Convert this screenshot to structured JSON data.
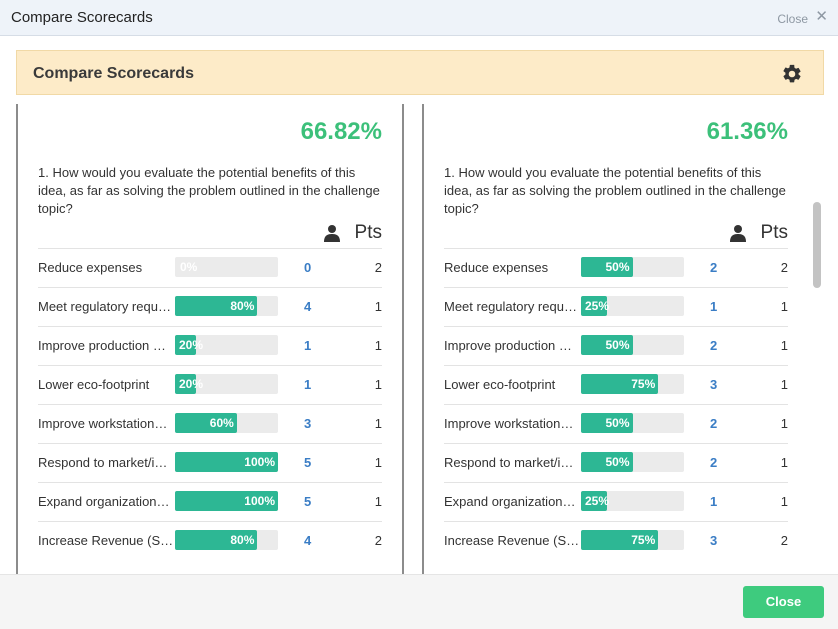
{
  "window": {
    "title": "Compare Scorecards",
    "close_link": "Close",
    "close_x": "✕"
  },
  "header": {
    "title": "Compare Scorecards",
    "gear_icon": "gear-icon"
  },
  "pts_label": "Pts",
  "scorecards": [
    {
      "score": "66.82%",
      "question": "1. How would you evaluate the potential benefits of this idea, as far as solving the problem outlined in the challenge topic?",
      "rows": [
        {
          "label": "Reduce expenses",
          "pct_value": 0,
          "pct": "0%",
          "count": "0",
          "pts": "2"
        },
        {
          "label": "Meet regulatory requ…",
          "pct_value": 80,
          "pct": "80%",
          "count": "4",
          "pts": "1"
        },
        {
          "label": "Improve production …",
          "pct_value": 20,
          "pct": "20%",
          "count": "1",
          "pts": "1"
        },
        {
          "label": "Lower eco-footprint",
          "pct_value": 20,
          "pct": "20%",
          "count": "1",
          "pts": "1"
        },
        {
          "label": "Improve workstation…",
          "pct_value": 60,
          "pct": "60%",
          "count": "3",
          "pts": "1"
        },
        {
          "label": "Respond to market/i…",
          "pct_value": 100,
          "pct": "100%",
          "count": "5",
          "pts": "1"
        },
        {
          "label": "Expand organization…",
          "pct_value": 100,
          "pct": "100%",
          "count": "5",
          "pts": "1"
        },
        {
          "label": "Increase Revenue (Sa…",
          "pct_value": 80,
          "pct": "80%",
          "count": "4",
          "pts": "2"
        }
      ]
    },
    {
      "score": "61.36%",
      "question": "1. How would you evaluate the potential benefits of this idea, as far as solving the problem outlined in the challenge topic?",
      "rows": [
        {
          "label": "Reduce expenses",
          "pct_value": 50,
          "pct": "50%",
          "count": "2",
          "pts": "2"
        },
        {
          "label": "Meet regulatory requ…",
          "pct_value": 25,
          "pct": "25%",
          "count": "1",
          "pts": "1"
        },
        {
          "label": "Improve production …",
          "pct_value": 50,
          "pct": "50%",
          "count": "2",
          "pts": "1"
        },
        {
          "label": "Lower eco-footprint",
          "pct_value": 75,
          "pct": "75%",
          "count": "3",
          "pts": "1"
        },
        {
          "label": "Improve workstation…",
          "pct_value": 50,
          "pct": "50%",
          "count": "2",
          "pts": "1"
        },
        {
          "label": "Respond to market/i…",
          "pct_value": 50,
          "pct": "50%",
          "count": "2",
          "pts": "1"
        },
        {
          "label": "Expand organization…",
          "pct_value": 25,
          "pct": "25%",
          "count": "1",
          "pts": "1"
        },
        {
          "label": "Increase Revenue (Sa…",
          "pct_value": 75,
          "pct": "75%",
          "count": "3",
          "pts": "2"
        }
      ]
    }
  ],
  "footer": {
    "close_button": "Close"
  },
  "colors": {
    "score_green": "#3cc07a",
    "bar_fill": "#2db794",
    "count_link": "#3a7dc5",
    "header_bg": "#fdebc8",
    "close_button_bg": "#3ecb7e"
  }
}
